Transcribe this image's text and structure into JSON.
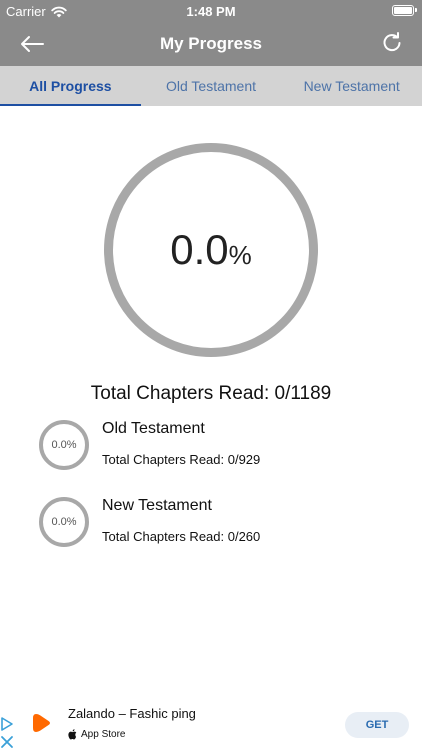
{
  "status_bar": {
    "carrier": "Carrier",
    "time": "1:48 PM"
  },
  "nav": {
    "title": "My Progress",
    "back_icon": "back-arrow-icon",
    "refresh_icon": "refresh-icon"
  },
  "tabs": [
    {
      "label": "All Progress",
      "active": true
    },
    {
      "label": "Old Testament",
      "active": false
    },
    {
      "label": "New Testament",
      "active": false
    }
  ],
  "overall": {
    "percent_value": "0.0",
    "percent_unit": "%",
    "progress_fraction": 0,
    "total_label": "Total Chapters Read: 0/1189"
  },
  "rows": [
    {
      "percent": "0.0%",
      "progress_fraction": 0,
      "title": "Old Testament",
      "subtitle": "Total Chapters Read: 0/929"
    },
    {
      "percent": "0.0%",
      "progress_fraction": 0,
      "title": "New Testament",
      "subtitle": "Total Chapters Read: 0/260"
    }
  ],
  "ad": {
    "title": "Zalando – Fashic         ping",
    "store": "App Store",
    "get_label": "GET"
  },
  "colors": {
    "header": "#8a8a8a",
    "tab_bar": "#d3d3d3",
    "tab_active": "#1d4fa3",
    "ring": "#a8a8a8",
    "get_button_text": "#2a6bb0",
    "app_logo": "#ff6900"
  }
}
